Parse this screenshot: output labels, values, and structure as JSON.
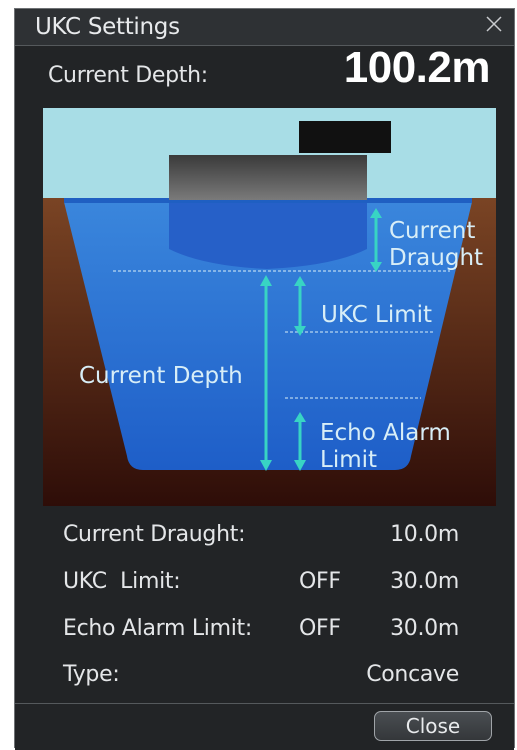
{
  "window": {
    "title": "UKC Settings",
    "close_icon": "close-icon"
  },
  "current_depth": {
    "label": "Current Depth:",
    "value": "100.2m"
  },
  "diagram": {
    "labels": {
      "current_draught_line1": "Current",
      "current_draught_line2": "Draught",
      "ukc_limit": "UKC Limit",
      "current_depth": "Current Depth",
      "echo_alarm_line1": "Echo Alarm",
      "echo_alarm_line2": "Limit"
    },
    "colors": {
      "sky": "#a8dde6",
      "seabed": "#5a2a17",
      "water": "#2f7ed6",
      "arrow": "#38d4c4",
      "hull": "#555555"
    }
  },
  "settings": {
    "current_draught": {
      "label": "Current Draught:",
      "value": "10.0m"
    },
    "ukc_limit": {
      "label": "UKC  Limit:",
      "status": "OFF",
      "value": "30.0m"
    },
    "echo_alarm_limit": {
      "label": "Echo Alarm Limit:",
      "status": "OFF",
      "value": "30.0m"
    },
    "type": {
      "label": "Type:",
      "value": "Concave"
    }
  },
  "footer": {
    "close_label": "Close"
  }
}
